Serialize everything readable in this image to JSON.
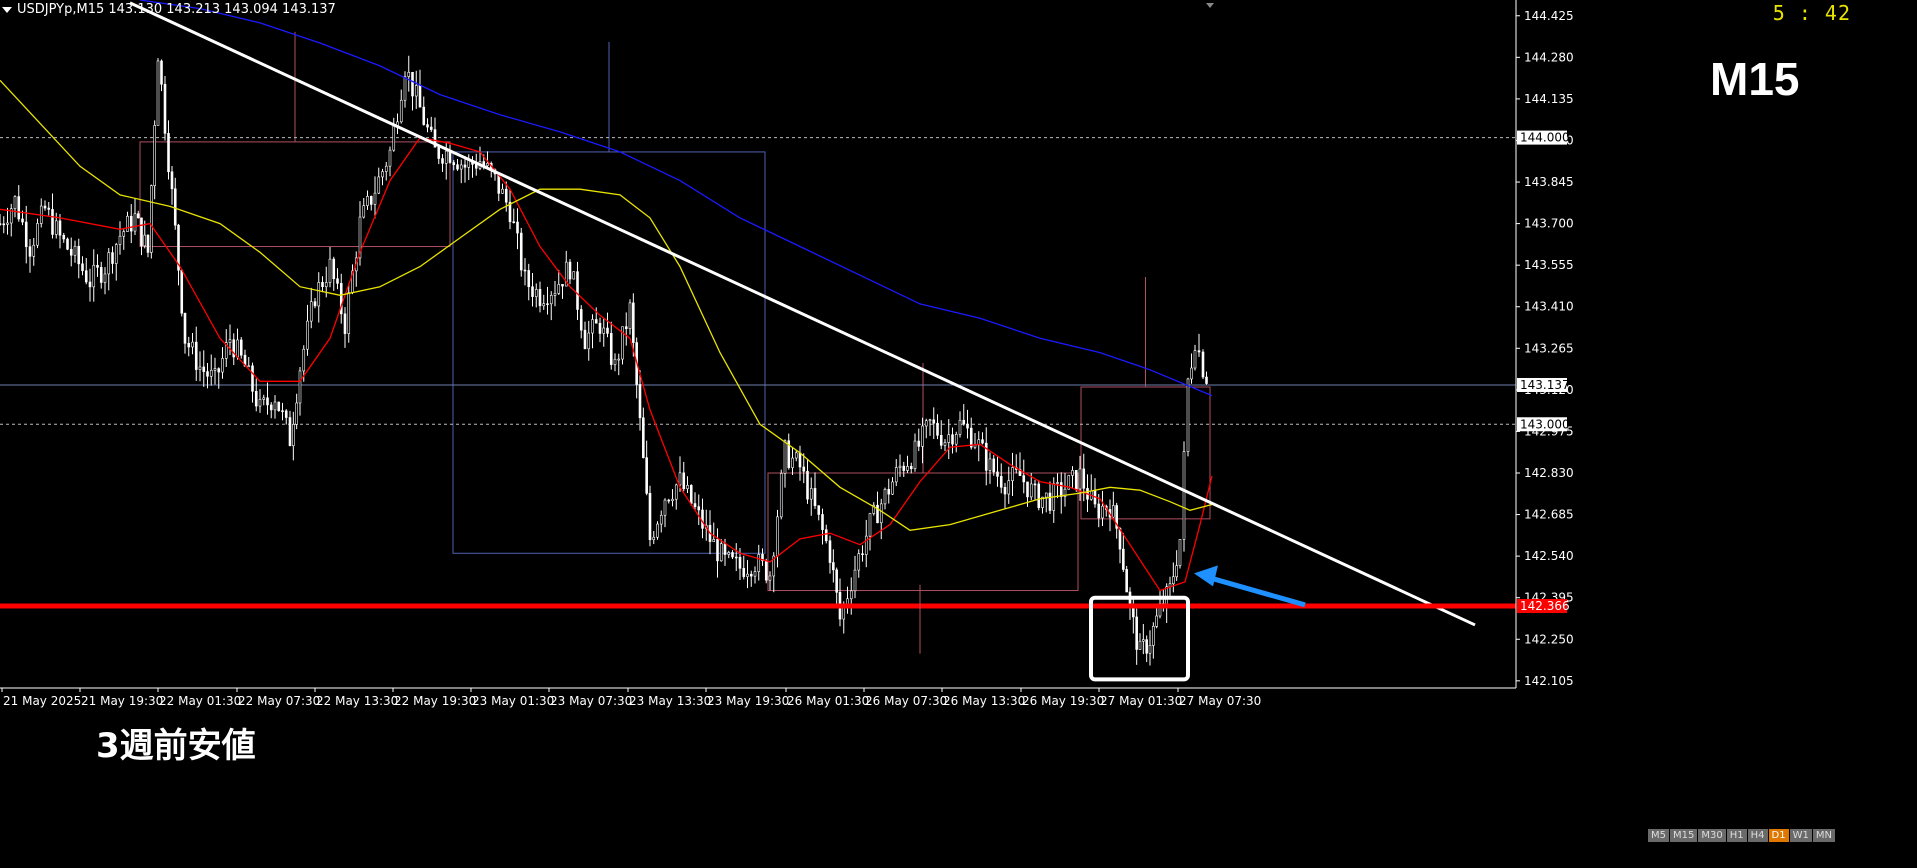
{
  "header": {
    "symbol_line": "USDJPYp,M15  143.130 143.213 143.094 143.137",
    "timer": "5 : 42"
  },
  "timeframe_label": "M15",
  "annotation_text": "3週前安値",
  "price_axis": {
    "ticks": [
      "144.425",
      "144.280",
      "144.135",
      "143.990",
      "143.845",
      "143.700",
      "143.555",
      "143.410",
      "143.265",
      "143.120",
      "142.975",
      "142.830",
      "142.685",
      "142.540",
      "142.395",
      "142.250",
      "142.105"
    ],
    "highlight_labels": [
      {
        "text": "144.000",
        "bg": "#ffffff",
        "color": "#000000"
      },
      {
        "text": "143.137",
        "bg": "#ffffff",
        "color": "#000000"
      },
      {
        "text": "143.000",
        "bg": "#ffffff",
        "color": "#000000"
      },
      {
        "text": "142.366",
        "bg": "#ff0000",
        "color": "#ffffff"
      }
    ]
  },
  "time_axis": {
    "ticks": [
      "21 May 2025",
      "21 May 19:30",
      "22 May 01:30",
      "22 May 07:30",
      "22 May 13:30",
      "22 May 19:30",
      "23 May 01:30",
      "23 May 07:30",
      "23 May 13:30",
      "23 May 19:30",
      "26 May 01:30",
      "26 May 07:30",
      "26 May 13:30",
      "26 May 19:30",
      "27 May 01:30",
      "27 May 07:30"
    ]
  },
  "period_buttons": [
    "M5",
    "M15",
    "M30",
    "H1",
    "H4",
    "D1",
    "W1",
    "MN"
  ],
  "active_period": "D1",
  "colors": {
    "background": "#000000",
    "candle": "#ffffff",
    "support_line": "#ff0000",
    "trendline": "#ffffff",
    "ma_fast": "#ff0000",
    "ma_mid": "#e8e400",
    "ma_slow": "#1a1aff",
    "arrow": "#1e90ff",
    "highlight_box": "#ffffff"
  },
  "chart_data": {
    "type": "candlestick",
    "symbol": "USDJPYp",
    "timeframe": "M15",
    "last_ohlc": {
      "open": 143.13,
      "high": 143.213,
      "low": 143.094,
      "close": 143.137
    },
    "ylim": [
      142.08,
      144.48
    ],
    "horizontal_levels": [
      144.0,
      143.137,
      143.0,
      142.366
    ],
    "support_level": 142.366,
    "close_path": [
      [
        0,
        143.7
      ],
      [
        15,
        143.78
      ],
      [
        30,
        143.62
      ],
      [
        45,
        143.75
      ],
      [
        60,
        143.65
      ],
      [
        75,
        143.58
      ],
      [
        90,
        143.5
      ],
      [
        105,
        143.55
      ],
      [
        120,
        143.66
      ],
      [
        135,
        143.72
      ],
      [
        148,
        143.6
      ],
      [
        158,
        144.3
      ],
      [
        172,
        143.8
      ],
      [
        185,
        143.3
      ],
      [
        200,
        143.2
      ],
      [
        215,
        143.15
      ],
      [
        230,
        143.3
      ],
      [
        245,
        143.2
      ],
      [
        260,
        143.05
      ],
      [
        275,
        143.1
      ],
      [
        290,
        142.95
      ],
      [
        300,
        143.2
      ],
      [
        315,
        143.45
      ],
      [
        330,
        143.55
      ],
      [
        345,
        143.35
      ],
      [
        360,
        143.7
      ],
      [
        375,
        143.82
      ],
      [
        390,
        143.95
      ],
      [
        405,
        144.25
      ],
      [
        420,
        144.1
      ],
      [
        435,
        143.95
      ],
      [
        450,
        143.95
      ],
      [
        465,
        143.9
      ],
      [
        480,
        143.92
      ],
      [
        495,
        143.85
      ],
      [
        510,
        143.75
      ],
      [
        525,
        143.5
      ],
      [
        540,
        143.45
      ],
      [
        555,
        143.48
      ],
      [
        570,
        143.55
      ],
      [
        585,
        143.3
      ],
      [
        600,
        143.35
      ],
      [
        615,
        143.2
      ],
      [
        630,
        143.4
      ],
      [
        640,
        143.0
      ],
      [
        650,
        142.6
      ],
      [
        665,
        142.75
      ],
      [
        680,
        142.8
      ],
      [
        695,
        142.7
      ],
      [
        710,
        142.6
      ],
      [
        725,
        142.52
      ],
      [
        740,
        142.5
      ],
      [
        755,
        142.52
      ],
      [
        770,
        142.48
      ],
      [
        785,
        142.9
      ],
      [
        800,
        142.85
      ],
      [
        815,
        142.7
      ],
      [
        830,
        142.55
      ],
      [
        840,
        142.32
      ],
      [
        855,
        142.5
      ],
      [
        870,
        142.65
      ],
      [
        885,
        142.75
      ],
      [
        900,
        142.85
      ],
      [
        915,
        142.9
      ],
      [
        930,
        143.0
      ],
      [
        945,
        142.95
      ],
      [
        960,
        143.0
      ],
      [
        975,
        142.95
      ],
      [
        990,
        142.85
      ],
      [
        1005,
        142.8
      ],
      [
        1020,
        142.82
      ],
      [
        1035,
        142.75
      ],
      [
        1050,
        142.74
      ],
      [
        1065,
        142.78
      ],
      [
        1080,
        142.82
      ],
      [
        1095,
        142.7
      ],
      [
        1110,
        142.72
      ],
      [
        1120,
        142.6
      ],
      [
        1130,
        142.35
      ],
      [
        1140,
        142.2
      ],
      [
        1150,
        142.25
      ],
      [
        1160,
        142.35
      ],
      [
        1170,
        142.42
      ],
      [
        1180,
        142.6
      ],
      [
        1188,
        143.15
      ],
      [
        1195,
        143.3
      ],
      [
        1203,
        143.2
      ],
      [
        1210,
        143.14
      ]
    ],
    "moving_averages": [
      {
        "name": "ma_fast",
        "color": "#ff0000",
        "points": [
          [
            0,
            143.75
          ],
          [
            60,
            143.72
          ],
          [
            120,
            143.68
          ],
          [
            150,
            143.7
          ],
          [
            180,
            143.55
          ],
          [
            220,
            143.3
          ],
          [
            260,
            143.15
          ],
          [
            300,
            143.15
          ],
          [
            330,
            143.3
          ],
          [
            360,
            143.6
          ],
          [
            390,
            143.85
          ],
          [
            420,
            144.0
          ],
          [
            450,
            143.98
          ],
          [
            480,
            143.95
          ],
          [
            510,
            143.82
          ],
          [
            540,
            143.62
          ],
          [
            570,
            143.48
          ],
          [
            600,
            143.38
          ],
          [
            630,
            143.3
          ],
          [
            650,
            143.05
          ],
          [
            680,
            142.78
          ],
          [
            710,
            142.62
          ],
          [
            740,
            142.55
          ],
          [
            770,
            142.52
          ],
          [
            800,
            142.6
          ],
          [
            830,
            142.62
          ],
          [
            860,
            142.58
          ],
          [
            890,
            142.65
          ],
          [
            920,
            142.8
          ],
          [
            950,
            142.92
          ],
          [
            980,
            142.93
          ],
          [
            1010,
            142.86
          ],
          [
            1040,
            142.8
          ],
          [
            1070,
            142.78
          ],
          [
            1100,
            142.74
          ],
          [
            1130,
            142.58
          ],
          [
            1160,
            142.42
          ],
          [
            1185,
            142.45
          ],
          [
            1200,
            142.65
          ],
          [
            1212,
            142.82
          ]
        ]
      },
      {
        "name": "ma_mid",
        "color": "#e8e400",
        "points": [
          [
            0,
            144.2
          ],
          [
            40,
            144.05
          ],
          [
            80,
            143.9
          ],
          [
            120,
            143.8
          ],
          [
            170,
            143.76
          ],
          [
            220,
            143.7
          ],
          [
            260,
            143.6
          ],
          [
            300,
            143.48
          ],
          [
            340,
            143.45
          ],
          [
            380,
            143.48
          ],
          [
            420,
            143.55
          ],
          [
            460,
            143.65
          ],
          [
            500,
            143.75
          ],
          [
            540,
            143.82
          ],
          [
            580,
            143.82
          ],
          [
            620,
            143.8
          ],
          [
            650,
            143.72
          ],
          [
            680,
            143.55
          ],
          [
            720,
            143.25
          ],
          [
            760,
            143.0
          ],
          [
            800,
            142.9
          ],
          [
            840,
            142.78
          ],
          [
            880,
            142.7
          ],
          [
            910,
            142.63
          ],
          [
            950,
            142.65
          ],
          [
            1000,
            142.7
          ],
          [
            1040,
            142.74
          ],
          [
            1080,
            142.76
          ],
          [
            1110,
            142.78
          ],
          [
            1140,
            142.77
          ],
          [
            1170,
            142.73
          ],
          [
            1190,
            142.7
          ],
          [
            1212,
            142.72
          ]
        ]
      },
      {
        "name": "ma_slow",
        "color": "#1a1aff",
        "points": [
          [
            140,
            144.48
          ],
          [
            200,
            144.45
          ],
          [
            260,
            144.4
          ],
          [
            320,
            144.33
          ],
          [
            380,
            144.25
          ],
          [
            440,
            144.15
          ],
          [
            500,
            144.08
          ],
          [
            560,
            144.02
          ],
          [
            620,
            143.95
          ],
          [
            680,
            143.85
          ],
          [
            740,
            143.72
          ],
          [
            800,
            143.62
          ],
          [
            860,
            143.52
          ],
          [
            920,
            143.42
          ],
          [
            980,
            143.37
          ],
          [
            1040,
            143.3
          ],
          [
            1100,
            143.25
          ],
          [
            1150,
            143.19
          ],
          [
            1212,
            143.1
          ]
        ]
      }
    ],
    "trendline": {
      "from": [
        130,
        144.47
      ],
      "to": [
        1475,
        142.3
      ]
    },
    "rectangles": [
      {
        "color": "#b05060",
        "x1": 140,
        "x2": 450,
        "y1": 143.985,
        "y2": 143.62
      },
      {
        "color": "#5060b0",
        "x1": 453,
        "x2": 765,
        "y1": 143.95,
        "y2": 142.55
      },
      {
        "color": "#b05060",
        "x1": 768,
        "x2": 1078,
        "y1": 142.83,
        "y2": 142.42
      },
      {
        "color": "#b05060",
        "x1": 1081,
        "x2": 1210,
        "y1": 143.13,
        "y2": 142.67
      }
    ]
  }
}
